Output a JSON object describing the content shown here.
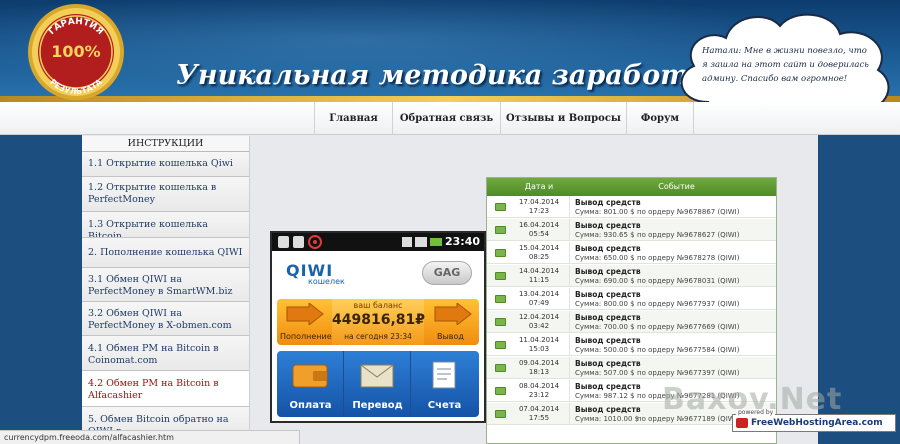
{
  "header": {
    "site_title": "Уникальная методика заработка!",
    "badge": {
      "top_text": "ГАРАНТИЯ",
      "percent": "100%",
      "bottom_text": "РЕЗУЛЬТАТА"
    },
    "testimonial": "Натали: Мне в жизни повезло, что я зашла на этот сайт и доверилась админу. Спасибо вам огромное!"
  },
  "nav": {
    "items": [
      {
        "label": "Главная"
      },
      {
        "label": "Обратная связь"
      },
      {
        "label": "Отзывы и Вопросы"
      },
      {
        "label": "Форум"
      }
    ]
  },
  "sidebar": {
    "heading": "ИНСТРУКЦИИ",
    "items": [
      {
        "label": "1.1 Открытие кошелька Qiwi",
        "active": false
      },
      {
        "label": "1.2 Открытие кошелька в PerfectMoney",
        "active": false
      },
      {
        "label": "1.3 Открытие кошелька Bitcoin",
        "active": false
      },
      {
        "label": "2. Пополнение кошелька QIWI",
        "active": false
      },
      {
        "label": "3.1 Обмен QIWI на PerfectMoney в SmartWM.biz",
        "active": false
      },
      {
        "label": "3.2 Обмен QIWI на PerfectMoney в X-obmen.com",
        "active": false
      },
      {
        "label": "4.1 Обмен PM на Bitcoin в Coinomat.com",
        "active": false
      },
      {
        "label": "4.2 Обмен PM на Bitcoin в Alfacashier",
        "active": true
      },
      {
        "label": "5. Обмен Bitcoin обратно на QIWI в",
        "active": false
      }
    ]
  },
  "phone": {
    "time": "23:40",
    "qiwi_word": "QIWI",
    "qiwi_sub": "кошелек",
    "ggo_label": "GAG",
    "balance_label": "ваш баланс",
    "balance_value": "449816,81₽",
    "balance_date": "на сегодня 23:34",
    "topup_label": "Пополнение",
    "withdraw_label": "Вывод",
    "actions": [
      {
        "label": "Оплата"
      },
      {
        "label": "Перевод"
      },
      {
        "label": "Счета"
      }
    ]
  },
  "table": {
    "col_date": "Дата и время",
    "col_event": "Событие",
    "rows": [
      {
        "date": "17.04.2014",
        "time": "17:23",
        "title": "Вывод средств",
        "sum": "Сумма: 801.00 $",
        "order": "по ордеру №9678867 (QIWI)"
      },
      {
        "date": "16.04.2014",
        "time": "05:54",
        "title": "Вывод средств",
        "sum": "Сумма: 930.65 $",
        "order": "по ордеру №9678627 (QIWI)"
      },
      {
        "date": "15.04.2014",
        "time": "08:25",
        "title": "Вывод средств",
        "sum": "Сумма: 650.00 $",
        "order": "по ордеру №9678278 (QIWI)"
      },
      {
        "date": "14.04.2014",
        "time": "11:15",
        "title": "Вывод средств",
        "sum": "Сумма: 690.00 $",
        "order": "по ордеру №9678031 (QIWI)"
      },
      {
        "date": "13.04.2014",
        "time": "07:49",
        "title": "Вывод средств",
        "sum": "Сумма: 800.00 $",
        "order": "по ордеру №9677937 (QIWI)"
      },
      {
        "date": "12.04.2014",
        "time": "03:42",
        "title": "Вывод средств",
        "sum": "Сумма: 700.00 $",
        "order": "по ордеру №9677669 (QIWI)"
      },
      {
        "date": "11.04.2014",
        "time": "15:03",
        "title": "Вывод средств",
        "sum": "Сумма: 500.00 $",
        "order": "по ордеру №9677584 (QIWI)"
      },
      {
        "date": "09.04.2014",
        "time": "18:13",
        "title": "Вывод средств",
        "sum": "Сумма: 507.00 $",
        "order": "по ордеру №9677397 (QIWI)"
      },
      {
        "date": "08.04.2014",
        "time": "23:12",
        "title": "Вывод средств",
        "sum": "Сумма: 987.12 $",
        "order": "по ордеру №9677281 (QIWI)"
      },
      {
        "date": "07.04.2014",
        "time": "17:55",
        "title": "Вывод средств",
        "sum": "Сумма: 1010.00 $",
        "order": "по ордеру №9677189 (QIWI)"
      }
    ]
  },
  "status_bar": {
    "url": "currencydpm.freeoda.com/alfacashier.htm"
  },
  "watermark": {
    "text": "Baxov.Net",
    "host_powered": "powered by",
    "host_name": "FreeWebHostingArea.com"
  },
  "colors": {
    "header_blue": "#1b5b94",
    "gold": "#f1cf5b",
    "table_green": "#5f9a33",
    "link_blue": "#1f3c66",
    "active_red": "#a21212",
    "qiwi_orange": "#f5a623",
    "qiwi_blue": "#1e6bc4"
  }
}
